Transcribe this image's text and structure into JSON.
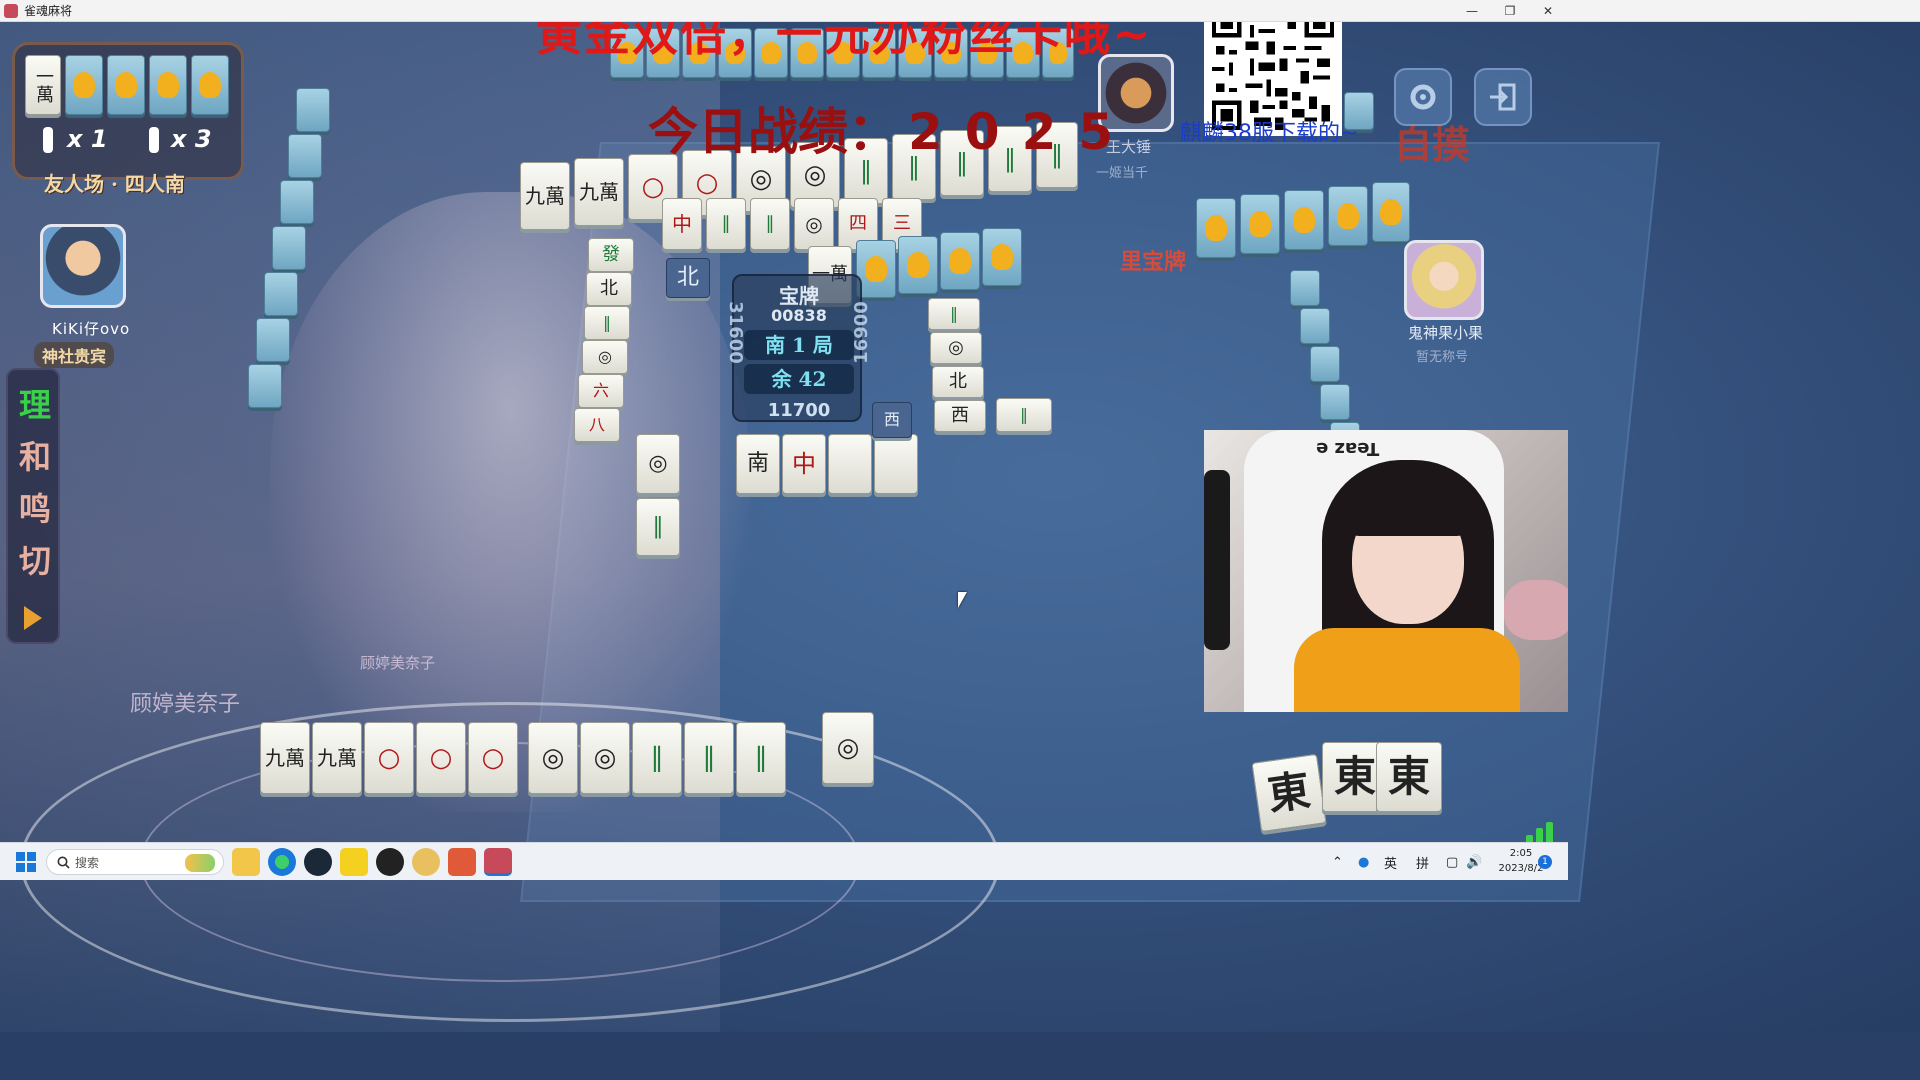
{
  "window": {
    "title": "雀魂麻将"
  },
  "overlay": {
    "promo_text": "黄金双倍，一元办粉丝卡哦~",
    "record_label": "今日战绩：",
    "record_value": "2025",
    "qr_caption": "麒麟38服下载的~"
  },
  "left_panel": {
    "wall_tile": "一萬",
    "counter_1": "x 1",
    "counter_2": "x 3",
    "room_label": "友人场 · 四人南",
    "player_name": "KiKi仔ovo",
    "player_title": "神社贵宾"
  },
  "side_menu": {
    "items": [
      "理",
      "和",
      "鸣",
      "切"
    ]
  },
  "opponents": {
    "right_name": "鬼神果小果",
    "right_title": "暂无称号",
    "top_name": "王大锤",
    "top_title": "一姬当千"
  },
  "center": {
    "dora_label": "宝牌",
    "score_top": "00838",
    "round": "南 1 局",
    "remaining": "余 42",
    "score_bottom": "11700",
    "score_left": "31600",
    "score_right": "16900"
  },
  "table": {
    "ura_dora_label": "里宝牌",
    "tsumo_label": "自摸",
    "self_nick": "顾婷美奈子",
    "self_nick_2": "顾婷美奈子",
    "discards_top": [
      "九萬",
      "九萬",
      "",
      "",
      "",
      "",
      "",
      "",
      "",
      ""
    ],
    "top_discard_row2": [
      "中",
      "",
      "",
      "北",
      "中"
    ],
    "hand": [
      "九萬",
      "九萬",
      "",
      "",
      "",
      "",
      "",
      "",
      "",
      ""
    ],
    "call_tiles": [
      "東",
      "東",
      "東"
    ]
  },
  "taskbar": {
    "search_placeholder": "搜索",
    "ime_1": "英",
    "ime_2": "拼",
    "time": "2:05",
    "date": "2023/8/2",
    "notification_count": "1"
  },
  "colors": {
    "promo": "#e01818",
    "record": "#9a0f0f",
    "qr_caption": "#1a3ccc",
    "active_menu": "#3ad04a",
    "signal": "#3ad04a"
  },
  "icons": [
    "app-icon",
    "minimize-icon",
    "maximize-icon",
    "close-icon",
    "settings-icon",
    "exit-icon",
    "windows-start-icon",
    "search-icon",
    "file-explorer-icon",
    "edge-icon",
    "steam-icon",
    "app-icon-yellow",
    "app-icon-black",
    "app-icon-owl",
    "app-icon-red",
    "mahjong-soul-icon",
    "tray-chevron-icon",
    "microphone-icon",
    "display-icon",
    "volume-icon",
    "signal-icon"
  ]
}
